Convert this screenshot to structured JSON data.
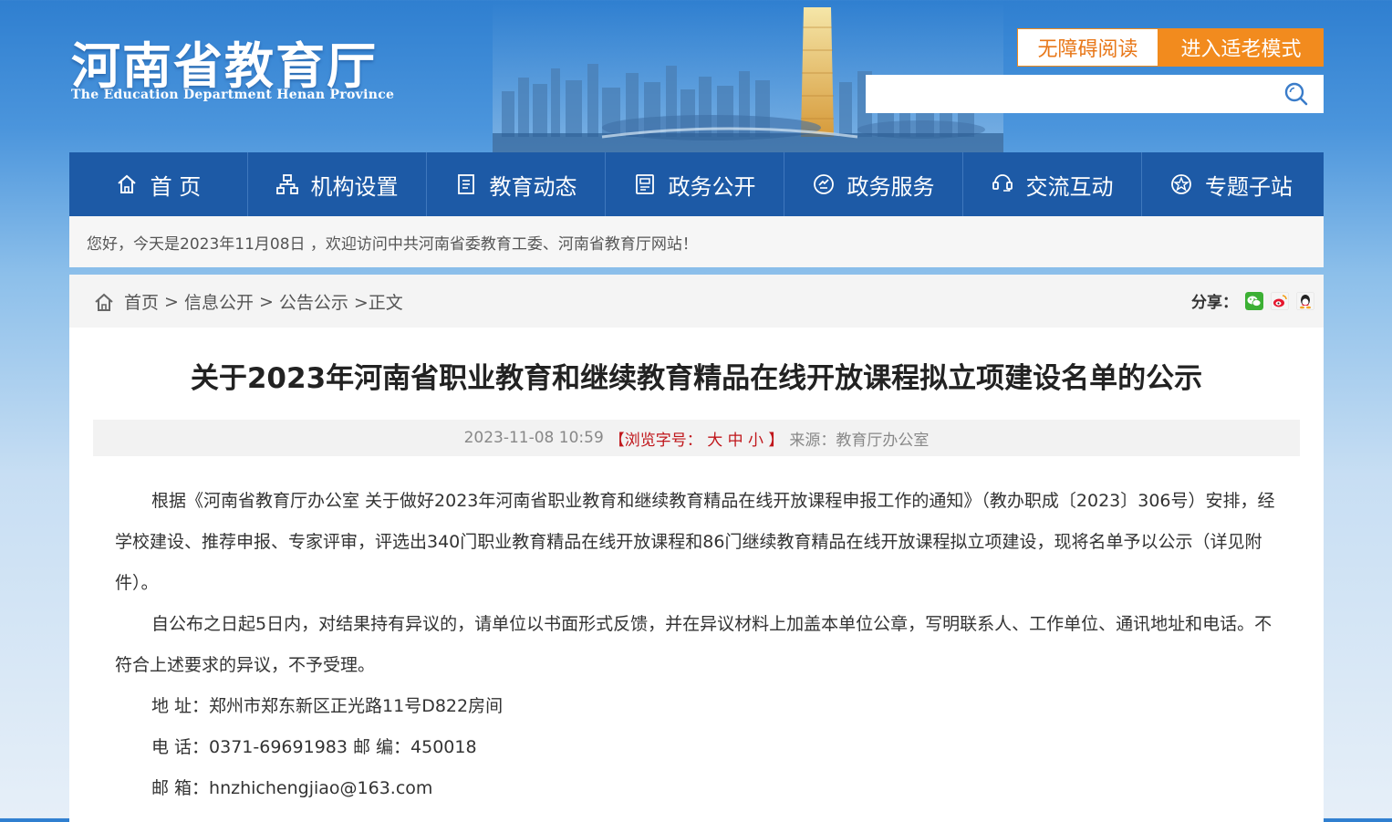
{
  "header": {
    "logo_cn": "河南省教育厅",
    "logo_en": "The Education Department Henan Province",
    "accessible_btn": "无障碍阅读",
    "elder_btn": "进入适老模式",
    "search_placeholder": ""
  },
  "nav": {
    "items": [
      {
        "label": "首 页",
        "icon": "home-icon"
      },
      {
        "label": "机构设置",
        "icon": "org-icon"
      },
      {
        "label": "教育动态",
        "icon": "news-icon"
      },
      {
        "label": "政务公开",
        "icon": "doc-icon"
      },
      {
        "label": "政务服务",
        "icon": "service-icon"
      },
      {
        "label": "交流互动",
        "icon": "chat-icon"
      },
      {
        "label": "专题子站",
        "icon": "topic-icon"
      }
    ]
  },
  "welcome": "您好，今天是2023年11月08日 ，欢迎访问中共河南省委教育工委、河南省教育厅网站！",
  "breadcrumb": {
    "home": "首页",
    "sep": ">",
    "level1": "信息公开",
    "level2": "公告公示",
    "current": ">正文"
  },
  "share": {
    "label": "分享："
  },
  "article": {
    "title": "关于2023年河南省职业教育和继续教育精品在线开放课程拟立项建设名单的公示",
    "datetime": "2023-11-08 10:59",
    "font_label": "【浏览字号：",
    "font_large": "大",
    "font_medium": "中",
    "font_small": "小",
    "font_close": "】",
    "source": "来源：教育厅办公室",
    "paragraphs": [
      "根据《河南省教育厅办公室 关于做好2023年河南省职业教育和继续教育精品在线开放课程申报工作的通知》（教办职成〔2023〕306号）安排，经学校建设、推荐申报、专家评审，评选出340门职业教育精品在线开放课程和86门继续教育精品在线开放课程拟立项建设，现将名单予以公示（详见附件）。",
      "自公布之日起5日内，对结果持有异议的，请单位以书面形式反馈，并在异议材料上加盖本单位公章，写明联系人、工作单位、通讯地址和电话。不符合上述要求的异议，不予受理。",
      "地 址：郑州市郑东新区正光路11号D822房间",
      "电 话：0371-69691983 邮 编：450018",
      "邮 箱：hnzhichengjiao@163.com"
    ]
  },
  "colors": {
    "nav_bg": "#1d5aa6",
    "accent_orange": "#f28b1e",
    "font_size_red": "#c0161b"
  }
}
